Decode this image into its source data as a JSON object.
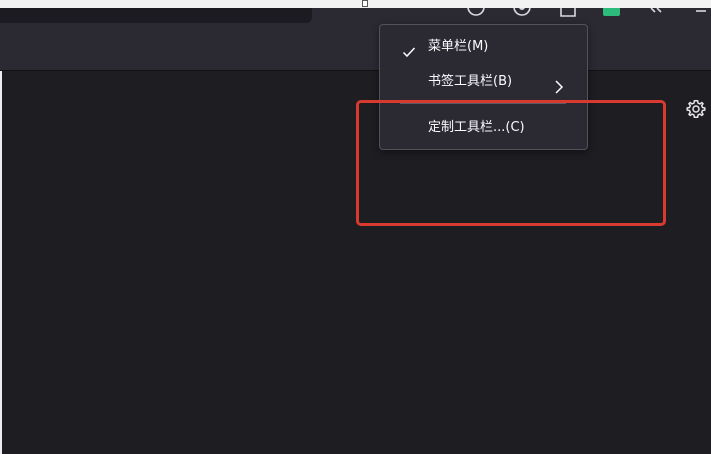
{
  "colors": {
    "toolbar_bg": "#2b2a33",
    "content_bg": "#1e1d22",
    "menu_bg": "#2b2a33",
    "menu_text": "#fbfbfe",
    "highlight_border": "#d93a2f",
    "extension_green": "#2dbb7c"
  },
  "toolbar": {
    "icons": [
      "history-icon",
      "account-icon",
      "downloads-icon",
      "extension-icon",
      "overflow-chevrons-icon",
      "menu-icon"
    ]
  },
  "context_menu": {
    "items": [
      {
        "label": "菜单栏(M)",
        "checked": true,
        "has_submenu": false,
        "icon": "checkmark-icon"
      },
      {
        "label": "书签工具栏(B)",
        "checked": false,
        "has_submenu": true,
        "icon": "chevron-right-icon"
      },
      {
        "label": "定制工具栏...(C)",
        "checked": false,
        "has_submenu": false
      }
    ]
  },
  "content": {
    "settings_icon": "gear-icon"
  }
}
